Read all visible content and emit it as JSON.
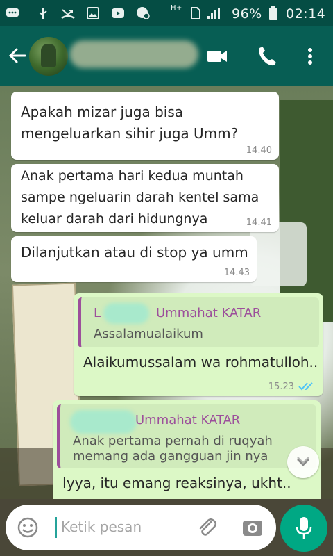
{
  "status_bar": {
    "battery_percent": "96%",
    "time": "02:14",
    "network_label": "H+"
  },
  "header": {
    "contact_name_redacted": true,
    "icons": [
      "back-arrow-icon",
      "videocam-icon",
      "phone-icon",
      "more-vert-icon"
    ]
  },
  "messages": [
    {
      "direction": "in",
      "text": "Apakah mizar juga bisa\nmengeluarkan sihir juga Umm?",
      "time": "14.40"
    },
    {
      "direction": "in",
      "text": "Anak pertama hari kedua muntah\nsampe ngeluarin darah kentel sama\nkeluar darah dari hidungnya",
      "time": "14.41"
    },
    {
      "direction": "in",
      "text": "Dilanjutkan atau di stop ya umm",
      "time": "14.43"
    },
    {
      "direction": "out",
      "quote_author": "Ummahat KATAR",
      "quote_author_prefix": "L",
      "quote_text": "Assalamualaikum",
      "text": "Alaikumussalam wa rohmatulloh..",
      "time": "15.23",
      "status": "read"
    },
    {
      "direction": "out",
      "quote_author": "Ummahat KATAR",
      "quote_text": "Anak pertama pernah di ruqyah\nmemang ada gangguan jin nya",
      "text": "Iyya, itu emang reaksinya, ukht..",
      "time": ""
    }
  ],
  "input": {
    "placeholder": "Ketik pesan"
  },
  "colors": {
    "header": "#075e54",
    "status_bar": "#054d44",
    "incoming_bubble": "#ffffff",
    "outgoing_bubble": "#dcf8c6",
    "quote_accent": "#9c4f9b",
    "read_ticks": "#4fc3f7",
    "fab": "#00a884"
  }
}
